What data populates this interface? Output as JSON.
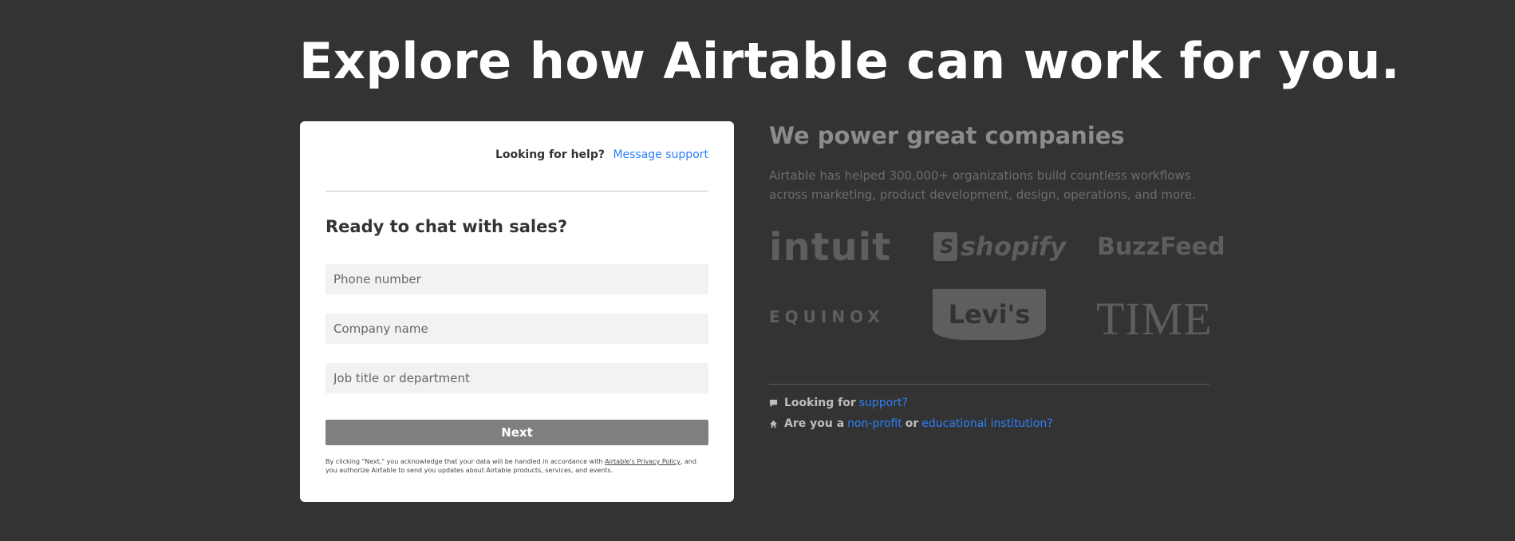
{
  "headline": "Explore how Airtable can work for you.",
  "card": {
    "help_text": "Looking for help?",
    "help_link": "Message support",
    "title": "Ready to chat with sales?",
    "fields": {
      "phone_placeholder": "Phone number",
      "company_placeholder": "Company name",
      "job_placeholder": "Job title or department"
    },
    "next_label": "Next",
    "disclaimer_before": "By clicking \"Next,\" you acknowledge that your data will be handled in accordance with",
    "disclaimer_link": "Airtable's Privacy Policy",
    "disclaimer_after": ", and you authorize Airtable to send you updates about Airtable products, services, and events."
  },
  "right": {
    "title": "We power great companies",
    "description": "Airtable has helped 300,000+ organizations build countless workflows across marketing, product development, design, operations, and more.",
    "logos": [
      "intuit",
      "shopify",
      "BuzzFeed",
      "EQUINOX",
      "Levi's",
      "TIME"
    ],
    "support_row": {
      "prefix": "Looking for",
      "link": "support?"
    },
    "nonprofit_row": {
      "prefix": "Are you a",
      "link1": "non-profit",
      "middle": "or",
      "link2": "educational institution?"
    }
  },
  "colors": {
    "background": "#333333",
    "accent": "#2d7ff9",
    "button": "#7f7f7f"
  }
}
